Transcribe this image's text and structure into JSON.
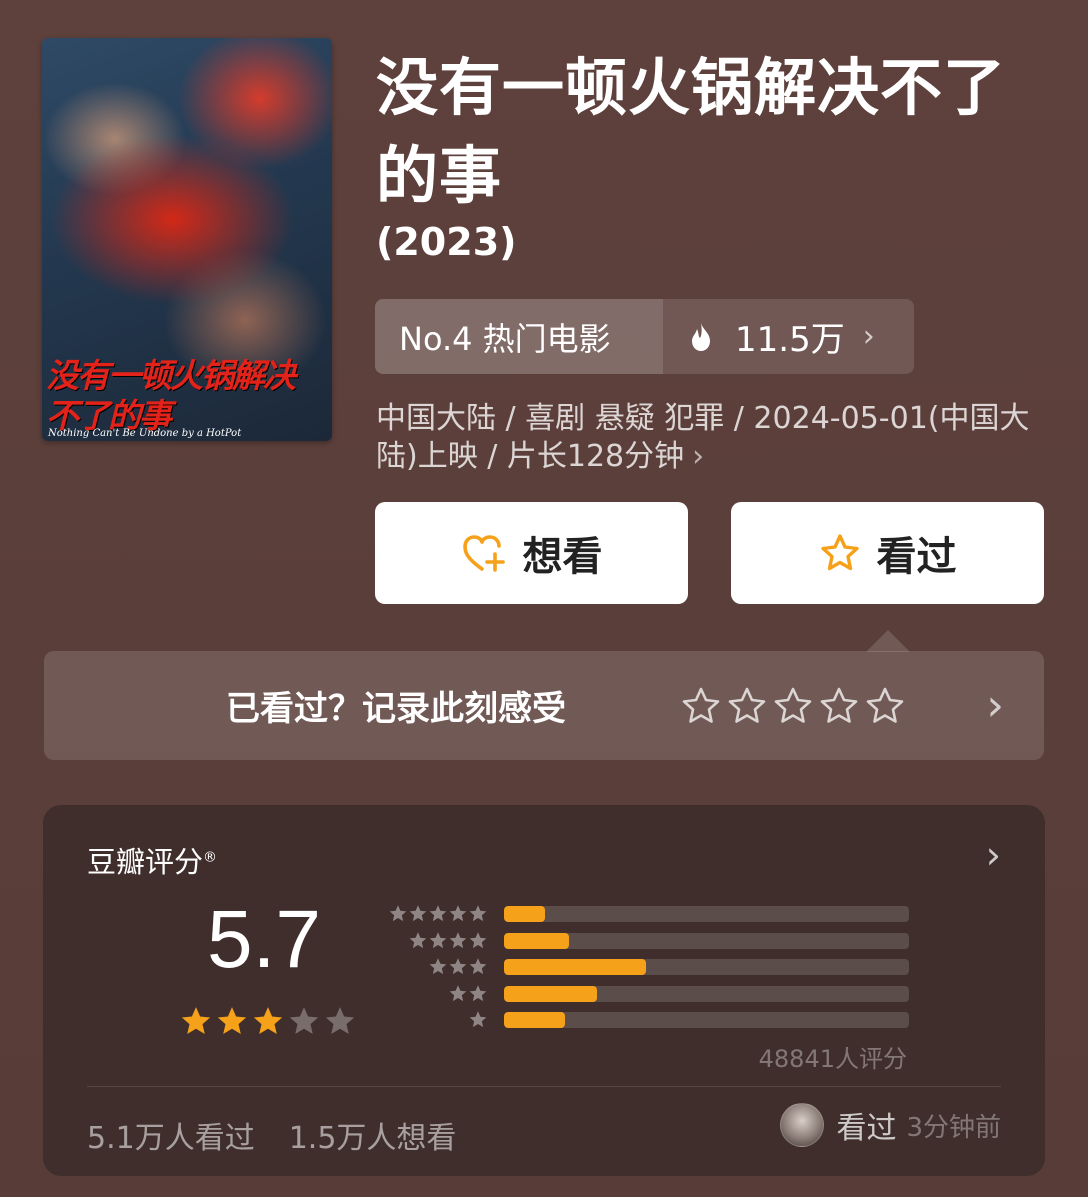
{
  "poster": {
    "title_text": "没有一顿火锅解决不了的事",
    "subtitle_text": "Nothing Can't Be Undone by a HotPot"
  },
  "movie": {
    "title": "没有一顿火锅解决不了的事",
    "year": "(2023)",
    "rank": "No.4 热门电影",
    "heat": "11.5万",
    "meta": "中国大陆 / 喜剧 悬疑 犯罪 / 2024-05-01(中国大陆)上映 / 片长128分钟"
  },
  "actions": {
    "want_label": "想看",
    "seen_label": "看过"
  },
  "record": {
    "prompt": "已看过？记录此刻感受"
  },
  "rating": {
    "title": "豆瓣评分",
    "registered_mark": "®",
    "score": "5.7",
    "score_stars": 3,
    "distribution": [
      {
        "stars": 5,
        "fraction": 0.1
      },
      {
        "stars": 4,
        "fraction": 0.16
      },
      {
        "stars": 3,
        "fraction": 0.35
      },
      {
        "stars": 2,
        "fraction": 0.23
      },
      {
        "stars": 1,
        "fraction": 0.15
      }
    ],
    "votes": "48841人评分",
    "seen_count": "5.1万人看过",
    "want_count": "1.5万人想看",
    "recent_action": "看过",
    "recent_time": "3分钟前"
  },
  "colors": {
    "accent": "#f6a11a",
    "background": "#5e413d",
    "card": "#3f2e2b"
  }
}
